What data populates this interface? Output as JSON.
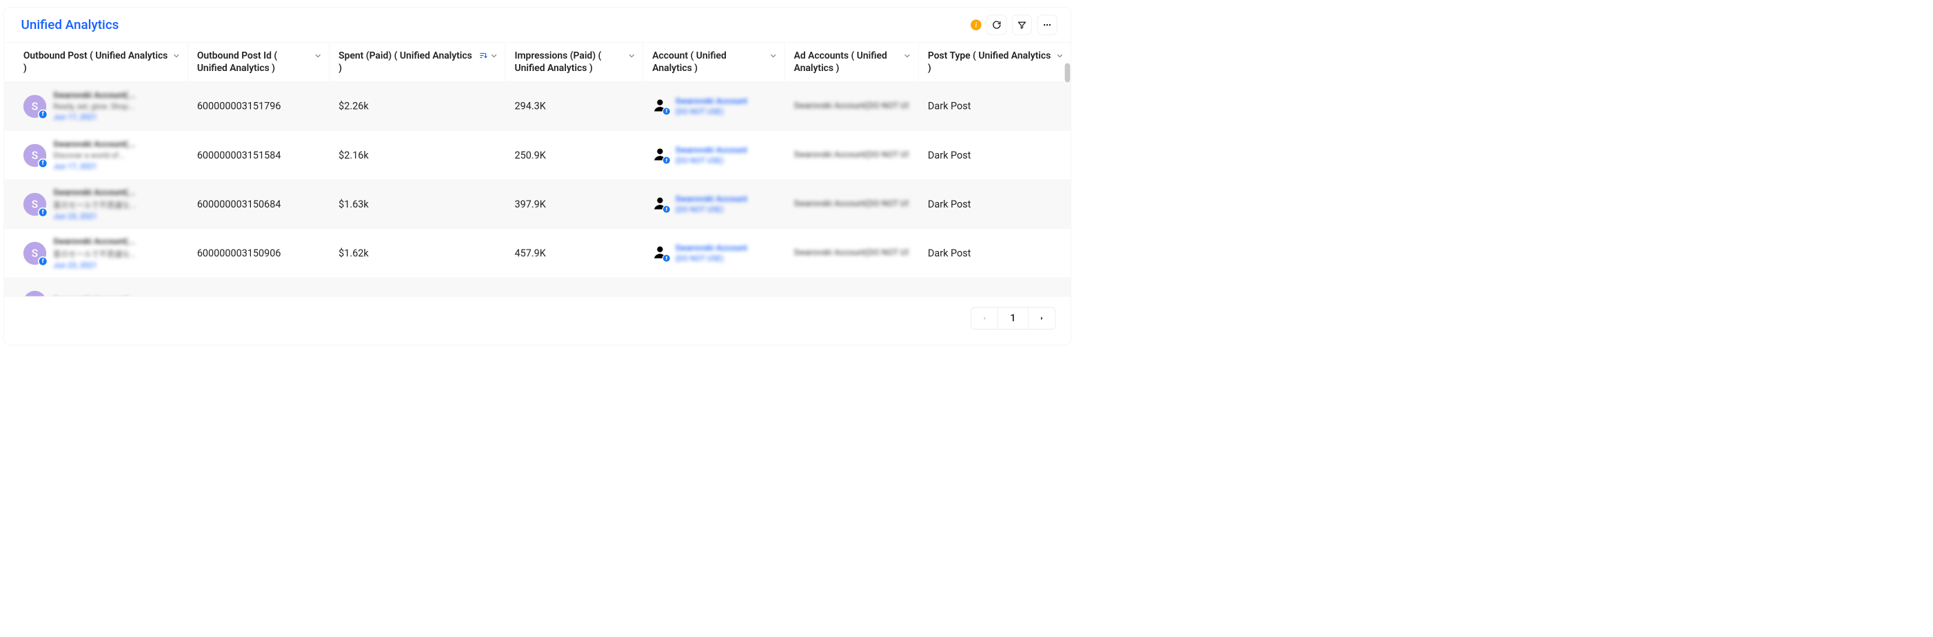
{
  "title": "Unified Analytics",
  "columns": [
    {
      "label": "Outbound Post ( Unified Analytics )",
      "sortable": true,
      "sorted": false
    },
    {
      "label": "Outbound Post Id ( Unified Analytics )",
      "sortable": true,
      "sorted": false
    },
    {
      "label": "Spent (Paid) ( Unified Analytics )",
      "sortable": true,
      "sorted": true
    },
    {
      "label": "Impressions (Paid) ( Unified Analytics )",
      "sortable": true,
      "sorted": false
    },
    {
      "label": "Account ( Unified Analytics )",
      "sortable": true,
      "sorted": false
    },
    {
      "label": "Ad Accounts ( Unified Analytics )",
      "sortable": true,
      "sorted": false
    },
    {
      "label": "Post Type ( Unified Analytics )",
      "sortable": true,
      "sorted": false
    }
  ],
  "rows": [
    {
      "avatar_letter": "S",
      "post_title_blur": "Swarovski Account(...",
      "post_sub_blur": "Ready, set, glow. Shop...",
      "post_date_blur": "Jun 17, 2021",
      "post_id": "600000003151796",
      "spent": "$2.26k",
      "impressions": "294.3K",
      "account_link_blur": "Swarovski Account",
      "account_sub_blur": "(DO NOT USE)",
      "ad_account_blur": "Swarovski Account(DO NOT USE)",
      "post_type": "Dark Post"
    },
    {
      "avatar_letter": "S",
      "post_title_blur": "Swarovski Account(...",
      "post_sub_blur": "Discover a world of...",
      "post_date_blur": "Jun 17, 2021",
      "post_id": "600000003151584",
      "spent": "$2.16k",
      "impressions": "250.9K",
      "account_link_blur": "Swarovski Account",
      "account_sub_blur": "(DO NOT USE)",
      "ad_account_blur": "Swarovski Account(DO NOT USE)",
      "post_type": "Dark Post"
    },
    {
      "avatar_letter": "S",
      "post_title_blur": "Swarovski Account(...",
      "post_sub_blur": "夏のセールで不思議な...",
      "post_date_blur": "Jun 23, 2021",
      "post_id": "600000003150684",
      "spent": "$1.63k",
      "impressions": "397.9K",
      "account_link_blur": "Swarovski Account",
      "account_sub_blur": "(DO NOT USE)",
      "ad_account_blur": "Swarovski Account(DO NOT USE)",
      "post_type": "Dark Post"
    },
    {
      "avatar_letter": "S",
      "post_title_blur": "Swarovski Account(...",
      "post_sub_blur": "夏のセールで不思議な...",
      "post_date_blur": "Jun 23, 2021",
      "post_id": "600000003150906",
      "spent": "$1.62k",
      "impressions": "457.9K",
      "account_link_blur": "Swarovski Account",
      "account_sub_blur": "(DO NOT USE)",
      "ad_account_blur": "Swarovski Account(DO NOT USE)",
      "post_type": "Dark Post"
    },
    {
      "avatar_letter": "S",
      "post_title_blur": "Swarovski Account(...",
      "post_sub_blur": "",
      "post_date_blur": "",
      "post_id": "",
      "spent": "",
      "impressions": "",
      "account_link_blur": "",
      "account_sub_blur": "",
      "ad_account_blur": "",
      "post_type": ""
    }
  ],
  "pagination": {
    "current": "1"
  },
  "icons": {
    "info": "i",
    "facebook": "f"
  }
}
